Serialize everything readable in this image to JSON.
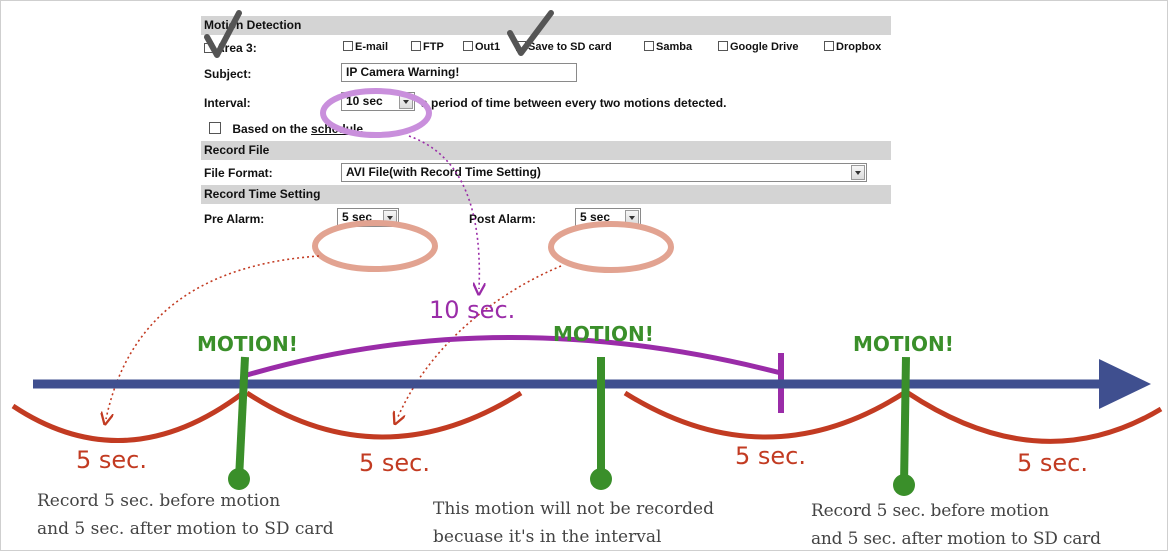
{
  "form": {
    "motion_detection": {
      "header": "Motion Detection",
      "area_label": "Area 3:",
      "options": [
        "E-mail",
        "FTP",
        "Out1",
        "Save to SD card",
        "Samba",
        "Google Drive",
        "Dropbox"
      ],
      "checked": [
        "Area 3:",
        "Save to SD card"
      ]
    },
    "subject": {
      "label": "Subject:",
      "value": "IP Camera Warning!"
    },
    "interval": {
      "label": "Interval:",
      "value": "10 sec",
      "note": "a period of time between every two motions detected."
    },
    "schedule": {
      "text": "Based on the",
      "link": "schedule"
    },
    "record_file": {
      "header": "Record File",
      "format_label": "File Format:",
      "format_value": "AVI File(with Record Time Setting)"
    },
    "record_time": {
      "header": "Record Time Setting",
      "pre_label": "Pre Alarm:",
      "pre_value": "5 sec",
      "post_label": "Post Alarm:",
      "post_value": "5 sec"
    }
  },
  "diagram": {
    "interval_label": "10 sec.",
    "motion_labels": [
      "MOTION!",
      "MOTION!",
      "MOTION!"
    ],
    "duration_labels": [
      "5 sec.",
      "5 sec.",
      "5 sec.",
      "5 sec."
    ],
    "captions": {
      "left": [
        "Record 5 sec. before motion",
        "and 5 sec. after motion to SD card"
      ],
      "middle": [
        "This motion will not be recorded",
        "becuase it's in the interval"
      ],
      "right": [
        "Record 5 sec. before motion",
        "and 5 sec. after motion to SD card"
      ]
    },
    "colors": {
      "timeline": "#3f4f8f",
      "motion": "#3a8f2a",
      "record": "#c23b22",
      "interval": "#9a2ca8",
      "highlight_purple": "#c98fdc",
      "highlight_salmon": "#e2a391"
    }
  }
}
